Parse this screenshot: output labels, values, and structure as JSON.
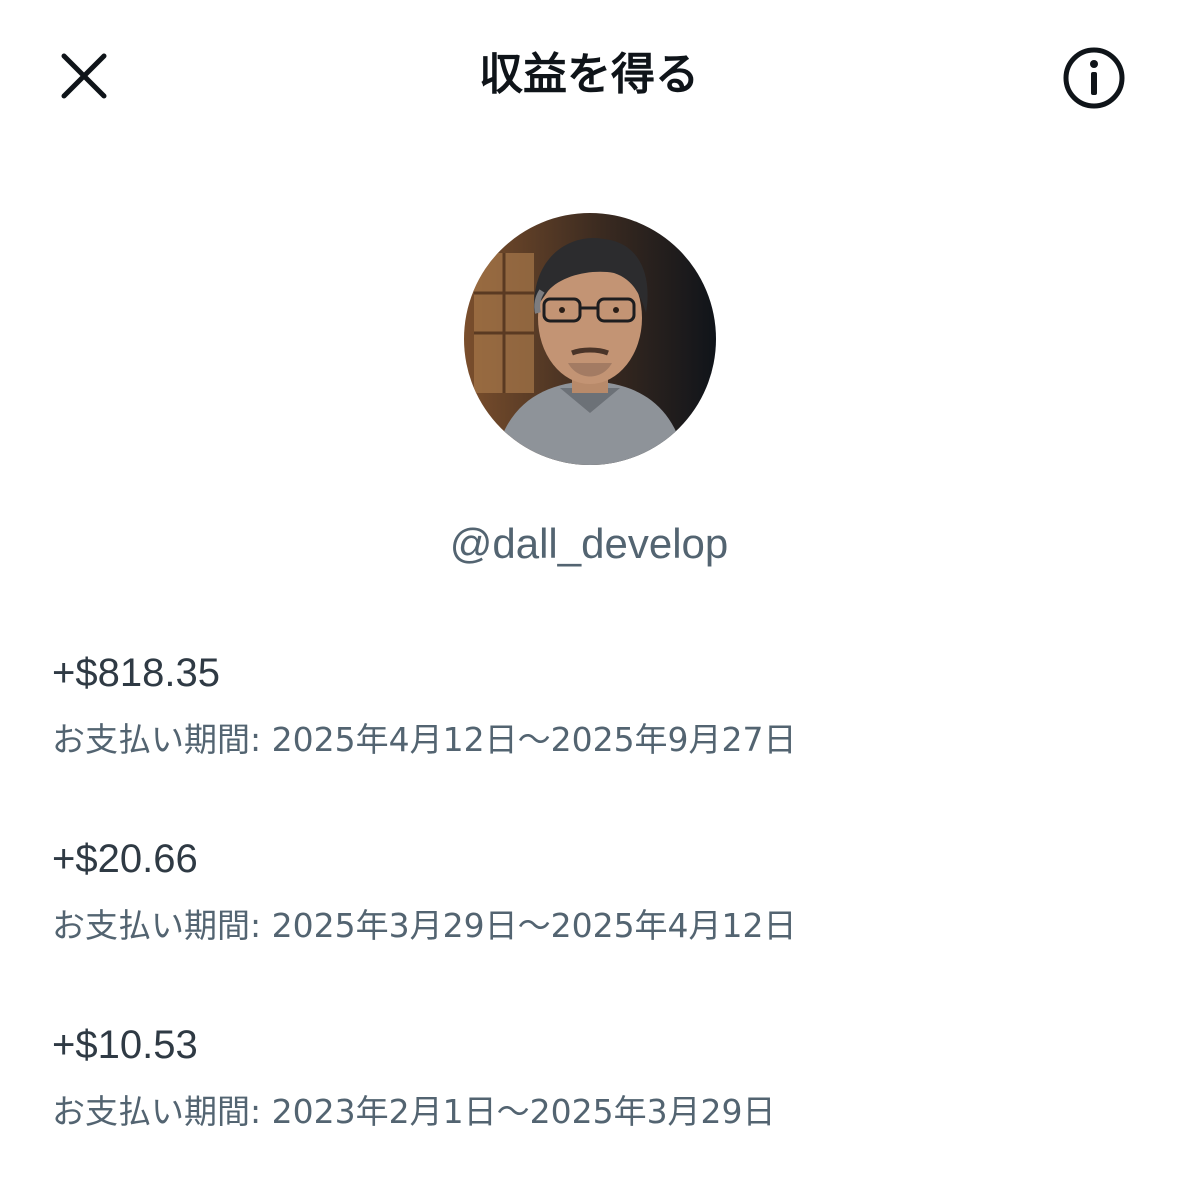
{
  "header": {
    "title": "収益を得る",
    "close_icon": "close-icon",
    "info_icon": "info-icon"
  },
  "profile": {
    "avatar": "avatar",
    "handle": "@dall_develop"
  },
  "payouts": [
    {
      "amount": "+$818.35",
      "period": "お支払い期間: 2025年4月12日〜2025年9月27日"
    },
    {
      "amount": "+$20.66",
      "period": "お支払い期間: 2025年3月29日〜2025年4月12日"
    },
    {
      "amount": "+$10.53",
      "period": "お支払い期間: 2023年2月1日〜2025年3月29日"
    }
  ],
  "colors": {
    "text_primary": "#0f1419",
    "text_secondary": "#536471",
    "background": "#ffffff"
  }
}
